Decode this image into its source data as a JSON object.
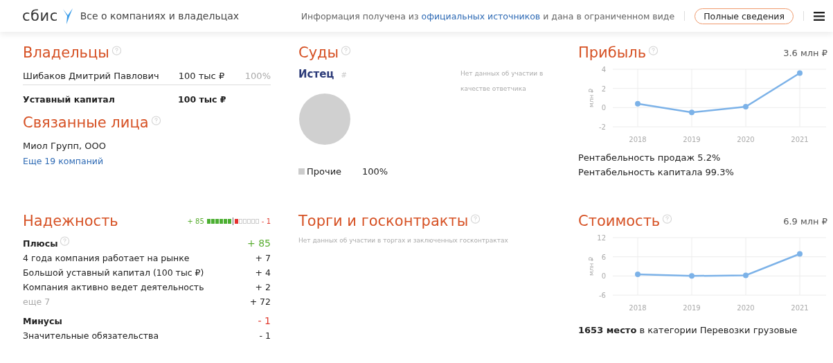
{
  "header": {
    "logo": "сбис",
    "title": "Все о компаниях и владельцах",
    "info": {
      "before": "Информация получена из",
      "link": "официальных источников",
      "after": "и дана в ограниченном виде"
    },
    "button": "Полные сведения"
  },
  "owners": {
    "title": "Владельцы",
    "rows": [
      {
        "name": "Шибаков Дмитрий Павлович",
        "amount": "100 тыс ₽",
        "share": "100%"
      }
    ],
    "capital": {
      "label": "Уставный капитал",
      "value": "100 тыс ₽"
    }
  },
  "related": {
    "title": "Связанные лица",
    "items": [
      "Миол Групп, ООО"
    ],
    "more": "Еще 19 компаний"
  },
  "courts": {
    "title": "Суды",
    "plaintiff": "Истец",
    "plaintiff_mark": "#",
    "no_data": "Нет данных об участии в качестве ответчика",
    "chart_data": {
      "type": "pie",
      "categories": [
        "Прочие"
      ],
      "values": [
        100
      ]
    },
    "legend": [
      {
        "value": "100%"
      }
    ]
  },
  "profit": {
    "title": "Прибыль",
    "value": "3.6 млн ₽",
    "chart_data": {
      "type": "line",
      "ylabel": "млн ₽",
      "x": [
        "2018",
        "2019",
        "2020",
        "2021"
      ],
      "series": [
        {
          "color": "#7cb2e8",
          "marker": true,
          "values": [
            0.4,
            -0.5,
            0.1,
            3.6
          ]
        }
      ],
      "grid": true,
      "ylim": [
        -2,
        4
      ],
      "yticks": [
        -2,
        0,
        2,
        4
      ]
    },
    "notes": [
      "Рентабельность продаж 5.2%",
      "Рентабельность капитала 99.3%"
    ]
  },
  "reliability": {
    "title": "Надежность",
    "plus_total": "+ 85",
    "minus_total": "- 1",
    "segments": [
      {
        "kind": "plus"
      },
      {
        "kind": "plus"
      },
      {
        "kind": "plus"
      },
      {
        "kind": "plus"
      },
      {
        "kind": "plus"
      },
      {
        "kind": "plus"
      },
      {
        "kind": "minus"
      },
      {
        "kind": "empty"
      },
      {
        "kind": "empty"
      },
      {
        "kind": "empty"
      },
      {
        "kind": "empty"
      },
      {
        "kind": "empty"
      }
    ],
    "groups": [
      {
        "kind": "plus",
        "label": "Плюсы",
        "total": "+ 85",
        "help": true,
        "rows": [
          {
            "label": "4 года компания работает на рынке",
            "value": "+ 7",
            "muted": false
          },
          {
            "label": "Большой уставный капитал (100 тыс ₽)",
            "value": "+ 4",
            "muted": false
          },
          {
            "label": "Компания активно ведет деятельность",
            "value": "+ 2",
            "muted": false
          },
          {
            "label": "еще 7",
            "value": "+ 72",
            "muted": true
          }
        ]
      },
      {
        "kind": "minus",
        "label": "Минусы",
        "total": "- 1",
        "help": false,
        "rows": [
          {
            "label": "Значительные обязательства",
            "value": "- 1",
            "muted": false
          }
        ]
      }
    ]
  },
  "tenders": {
    "title": "Торги и госконтракты",
    "no_data": "Нет данных об участии в торгах и заключенных госконтрактах"
  },
  "cost": {
    "title": "Стоимость",
    "value": "6.9 млн ₽",
    "chart_data": {
      "type": "line",
      "ylabel": "млн ₽",
      "x": [
        "2018",
        "2019",
        "2020",
        "2021"
      ],
      "series": [
        {
          "color": "#7cb2e8",
          "marker": true,
          "values": [
            0.5,
            0,
            0.2,
            6.9
          ]
        }
      ],
      "grid": true,
      "ylim": [
        -6,
        12
      ],
      "yticks": [
        -6,
        0,
        6,
        12
      ]
    },
    "rank": "**1653 место** в категории Перевозки грузовые"
  }
}
